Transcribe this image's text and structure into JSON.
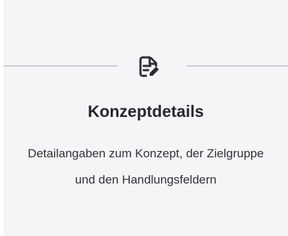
{
  "section": {
    "title": "Konzeptdetails",
    "description": "Detailangaben zum Konzept, der Zielgruppe und den Handlungsfeldern",
    "icon": "document-edit-icon"
  },
  "colors": {
    "background": "#f4f5f6",
    "divider": "#c9ccd1",
    "icon": "#2b2e33",
    "title": "#26282c",
    "text": "#2f3236"
  }
}
